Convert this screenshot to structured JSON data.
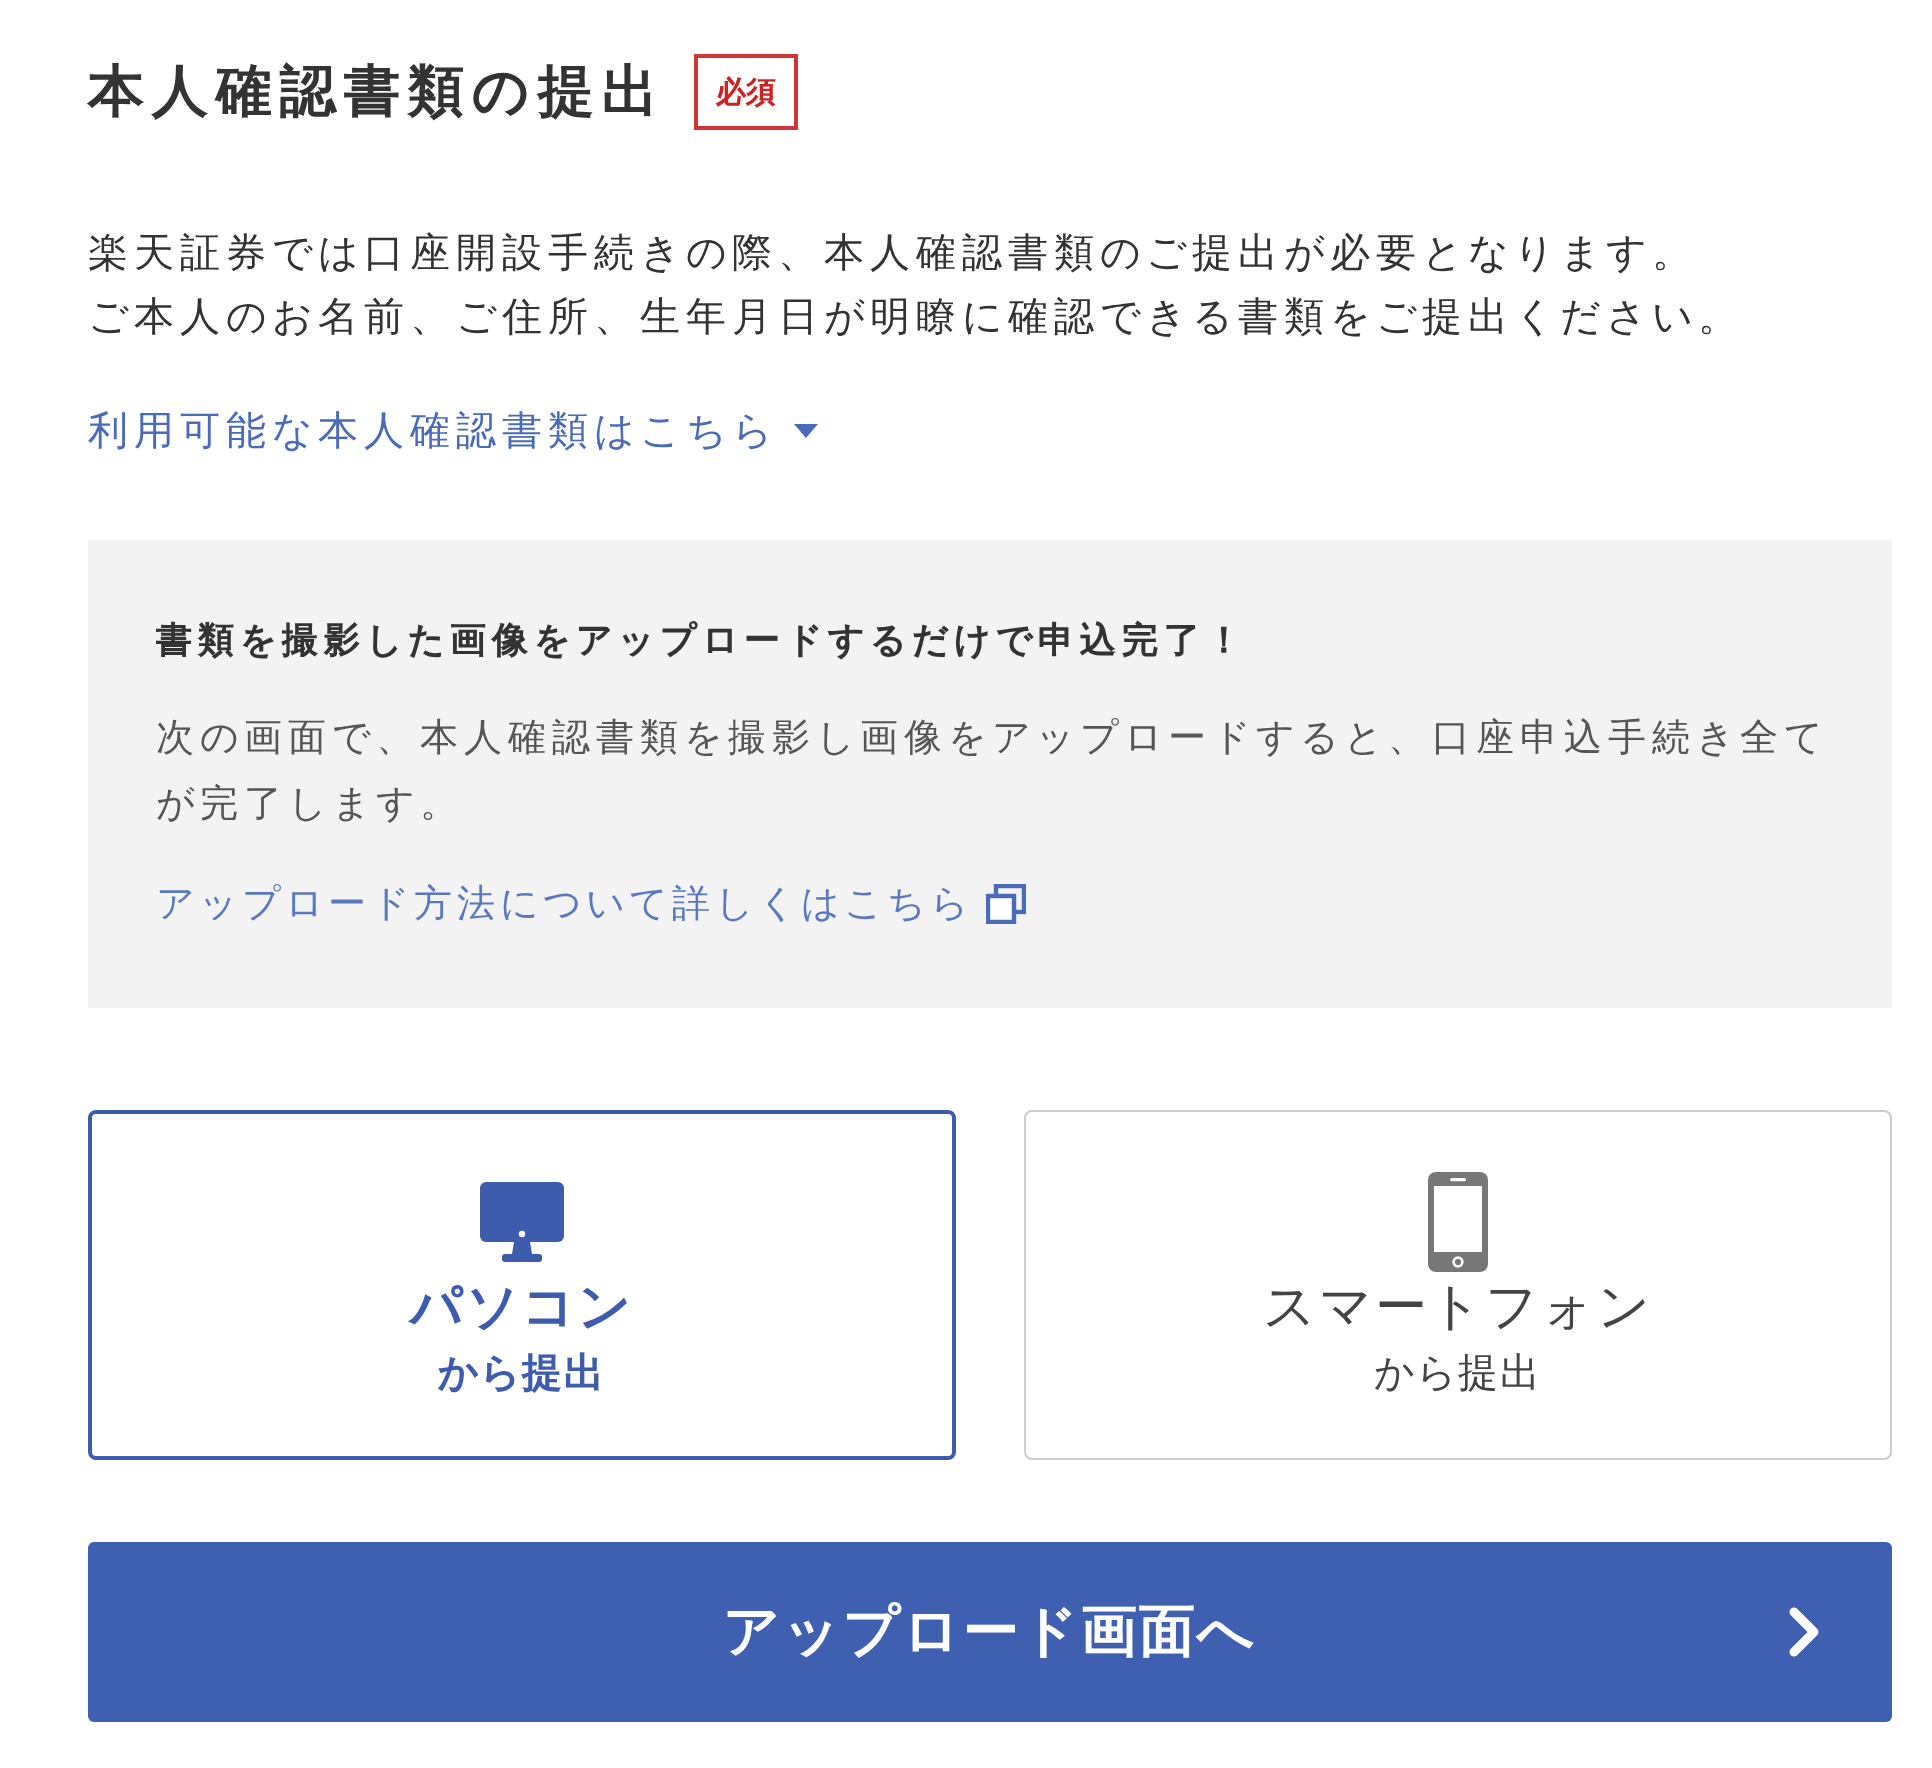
{
  "heading": {
    "title": "本人確認書類の提出",
    "badge": "必須"
  },
  "description": [
    "楽天証券では口座開設手続きの際、本人確認書類のご提出が必要となります。",
    "ご本人のお名前、ご住所、生年月日が明瞭に確認できる書類をご提出ください。"
  ],
  "documents_link": {
    "label": "利用可能な本人確認書類はこちら",
    "expanded": false
  },
  "notice": {
    "title": "書類を撮影した画像をアップロードするだけで申込完了！",
    "text": "次の画面で、本人確認書類を撮影し画像をアップロードすると、口座申込手続き全てが完了します。",
    "link": "アップロード方法について詳しくはこちら"
  },
  "options": [
    {
      "kind": "pc",
      "title": "パソコン",
      "subtitle": "から提出",
      "selected": true
    },
    {
      "kind": "smartphone",
      "title": "スマートフォン",
      "subtitle": "から提出",
      "selected": false
    }
  ],
  "submit_button": {
    "label": "アップロード画面へ"
  }
}
